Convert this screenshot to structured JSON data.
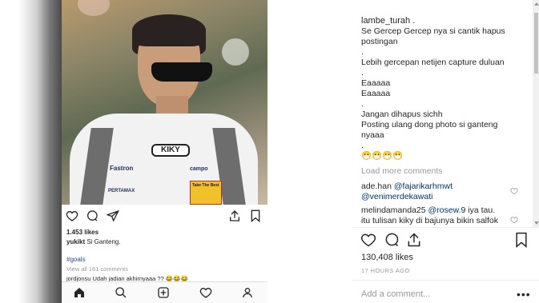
{
  "phone": {
    "photo_texts": {
      "logo": "KIKY",
      "brand1": "Fastron",
      "brand2": "PERTAMAX",
      "brand3": "campo",
      "badge": "Take The Best"
    },
    "likes": "1.453 likes",
    "caption_user": "yukikt",
    "caption_text": " Si Ganteng.",
    "tag": "#goals",
    "view_all": "View all 161 comments",
    "comment_preview": "jordjonsu Udah jadian akhirnyaaa ?? 😂😂😂"
  },
  "post": {
    "username": "lambe_turah",
    "username_suffix": " .",
    "caption_lines": [
      "Se Gercep Gercep nya si cantik hapus",
      "postingan",
      ".",
      "Lebih gercepan netijen capture duluan",
      ".",
      "Eaaaaa",
      "Eaaaaa",
      ".",
      "Jangan dihapus sichh",
      "Posting ulang dong photo si ganteng",
      "nyaaa",
      ".",
      "😷😷😷😷"
    ],
    "load_more": "Load more comments",
    "comments": [
      {
        "user": "ade.han",
        "mention1": "@fajarikarhmwt",
        "mention2": "@venimerdekawati"
      },
      {
        "user": "melindamanda25",
        "mention": "@rosew.9",
        "text1": " iya tau.",
        "text2": "itu tulisan kiky di bajunya bikin salfok"
      }
    ],
    "likes": "130,408 likes",
    "timestamp": "17 HOURS AGO",
    "add_comment_placeholder": "Add a comment...",
    "more_label": "•••"
  },
  "colors": {
    "text": "#262626",
    "muted": "#999999",
    "link": "#003569"
  },
  "icons": [
    "heart-icon",
    "comment-icon",
    "share-icon",
    "bookmark-icon",
    "home-icon",
    "search-icon",
    "add-icon",
    "activity-icon",
    "profile-icon",
    "more-icon"
  ]
}
